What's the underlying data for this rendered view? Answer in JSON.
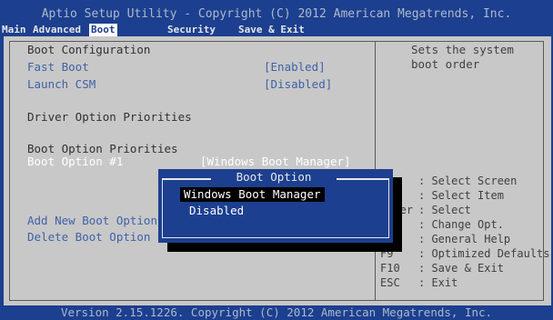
{
  "header": {
    "title": "Aptio Setup Utility - Copyright (C) 2012 American Megatrends, Inc.",
    "tabs": [
      {
        "label": "Main"
      },
      {
        "label": "Advanced"
      },
      {
        "label": "Boot"
      },
      {
        "label": "Security"
      },
      {
        "label": "Save & Exit"
      }
    ],
    "active_tab": "Boot"
  },
  "settings": {
    "boot_config_heading": "Boot Configuration",
    "fast_boot_label": "Fast Boot",
    "fast_boot_value": "[Enabled]",
    "launch_csm_label": "Launch CSM",
    "launch_csm_value": "[Disabled]",
    "driver_heading": "Driver Option Priorities",
    "boot_priorities_heading": "Boot Option Priorities",
    "boot_option1_label": "Boot Option #1",
    "boot_option1_value": "[Windows Boot Manager]",
    "add_new_label": "Add New Boot Option",
    "delete_label": "Delete Boot Option"
  },
  "help": {
    "line1": "Sets the system",
    "line2": "boot order"
  },
  "keys": [
    {
      "key": "→←",
      "desc": ": Select Screen"
    },
    {
      "key": "↑↓",
      "desc": ": Select Item"
    },
    {
      "key": "Enter",
      "desc": ": Select"
    },
    {
      "key": "+/-",
      "desc": ": Change Opt."
    },
    {
      "key": "F1",
      "desc": ": General Help"
    },
    {
      "key": "F9",
      "desc": ": Optimized Defaults"
    },
    {
      "key": "F10",
      "desc": ": Save & Exit"
    },
    {
      "key": "ESC",
      "desc": ": Exit"
    }
  ],
  "popup": {
    "title": "Boot Option",
    "options": [
      "Windows Boot Manager",
      "Disabled"
    ],
    "selected": "Windows Boot Manager"
  },
  "footer": {
    "version": "Version 2.15.1226. Copyright (C) 2012 American Megatrends, Inc."
  },
  "colors": {
    "background_blue": "#1c3f8f",
    "panel_gray": "#c8c8c8",
    "option_blue": "#3f62a8"
  }
}
